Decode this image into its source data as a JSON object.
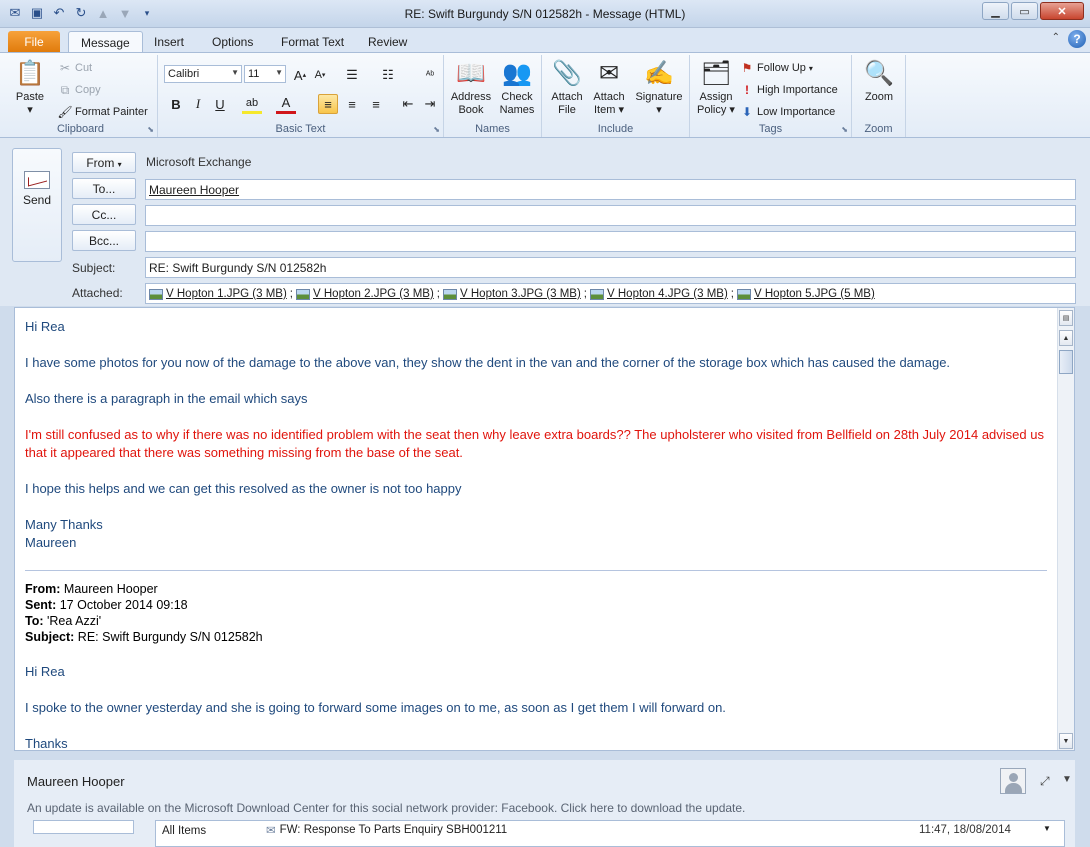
{
  "window": {
    "title": "RE: Swift Burgundy S/N  012582h  -  Message (HTML)"
  },
  "tabs": [
    {
      "label": "File"
    },
    {
      "label": "Message"
    },
    {
      "label": "Insert"
    },
    {
      "label": "Options"
    },
    {
      "label": "Format Text"
    },
    {
      "label": "Review"
    }
  ],
  "ribbon": {
    "clipboard": {
      "label": "Clipboard",
      "paste": "Paste",
      "cut": "Cut",
      "copy": "Copy",
      "format_painter": "Format Painter"
    },
    "basic_text": {
      "label": "Basic Text",
      "font": "Calibri",
      "size": "11"
    },
    "names": {
      "label": "Names",
      "address_book": "Address Book",
      "check_names": "Check Names"
    },
    "include": {
      "label": "Include",
      "attach_file": "Attach File",
      "attach_item": "Attach Item",
      "signature": "Signature"
    },
    "tags": {
      "label": "Tags",
      "assign_policy": "Assign Policy",
      "follow_up": "Follow Up",
      "high_importance": "High Importance",
      "low_importance": "Low Importance"
    },
    "zoom": {
      "label": "Zoom",
      "zoom": "Zoom"
    }
  },
  "header": {
    "send": "Send",
    "from_button": "From",
    "from_value": "Microsoft Exchange",
    "to_button": "To...",
    "to_value": "Maureen Hooper",
    "cc_button": "Cc...",
    "bcc_button": "Bcc...",
    "subject_label": "Subject:",
    "subject_value": "RE: Swift Burgundy S/N  012582h",
    "attached_label": "Attached:",
    "attachments": [
      "V Hopton 1.JPG (3 MB)",
      "V Hopton 2.JPG (3 MB)",
      "V Hopton 3.JPG (3 MB)",
      "V Hopton 4.JPG (3 MB)",
      "V Hopton 5.JPG (5 MB)"
    ]
  },
  "body": {
    "greeting": "Hi Rea",
    "p1": "I have some photos for you now of the damage to the above van, they show the dent in the van and the corner of the storage box which has caused the damage.",
    "p2": "Also there is a paragraph in the email which says",
    "quote": "I'm still confused as to why if there was no identified problem with the seat then why leave extra boards??  The upholsterer who visited from Bellfield on 28th July 2014 advised us that it appeared that there was something missing from the base of the seat.",
    "p3": "I hope this helps and we can get this resolved as the owner is not too happy",
    "signoff1": "Many Thanks",
    "signoff2": "Maureen",
    "prev": {
      "from_label": "From:",
      "from": "Maureen Hooper",
      "sent_label": "Sent:",
      "sent": "17 October 2014 09:18",
      "to_label": "To:",
      "to": "'Rea Azzi'",
      "subject_label": "Subject:",
      "subject": "RE: Swift Burgundy S/N 012582h",
      "greeting": "Hi Rea",
      "p1": "I spoke to the owner yesterday and she is going to forward some images on to me, as soon as I get them I will forward on.",
      "thanks": "Thanks"
    }
  },
  "people_pane": {
    "name": "Maureen Hooper",
    "update": "An update is available on the Microsoft Download Center for this social network provider: Facebook. Click here to download the update.",
    "all_items": "All Items",
    "item_subject": "FW: Response To Parts Enquiry SBH001211",
    "item_time": "11:47, 18/08/2014"
  }
}
